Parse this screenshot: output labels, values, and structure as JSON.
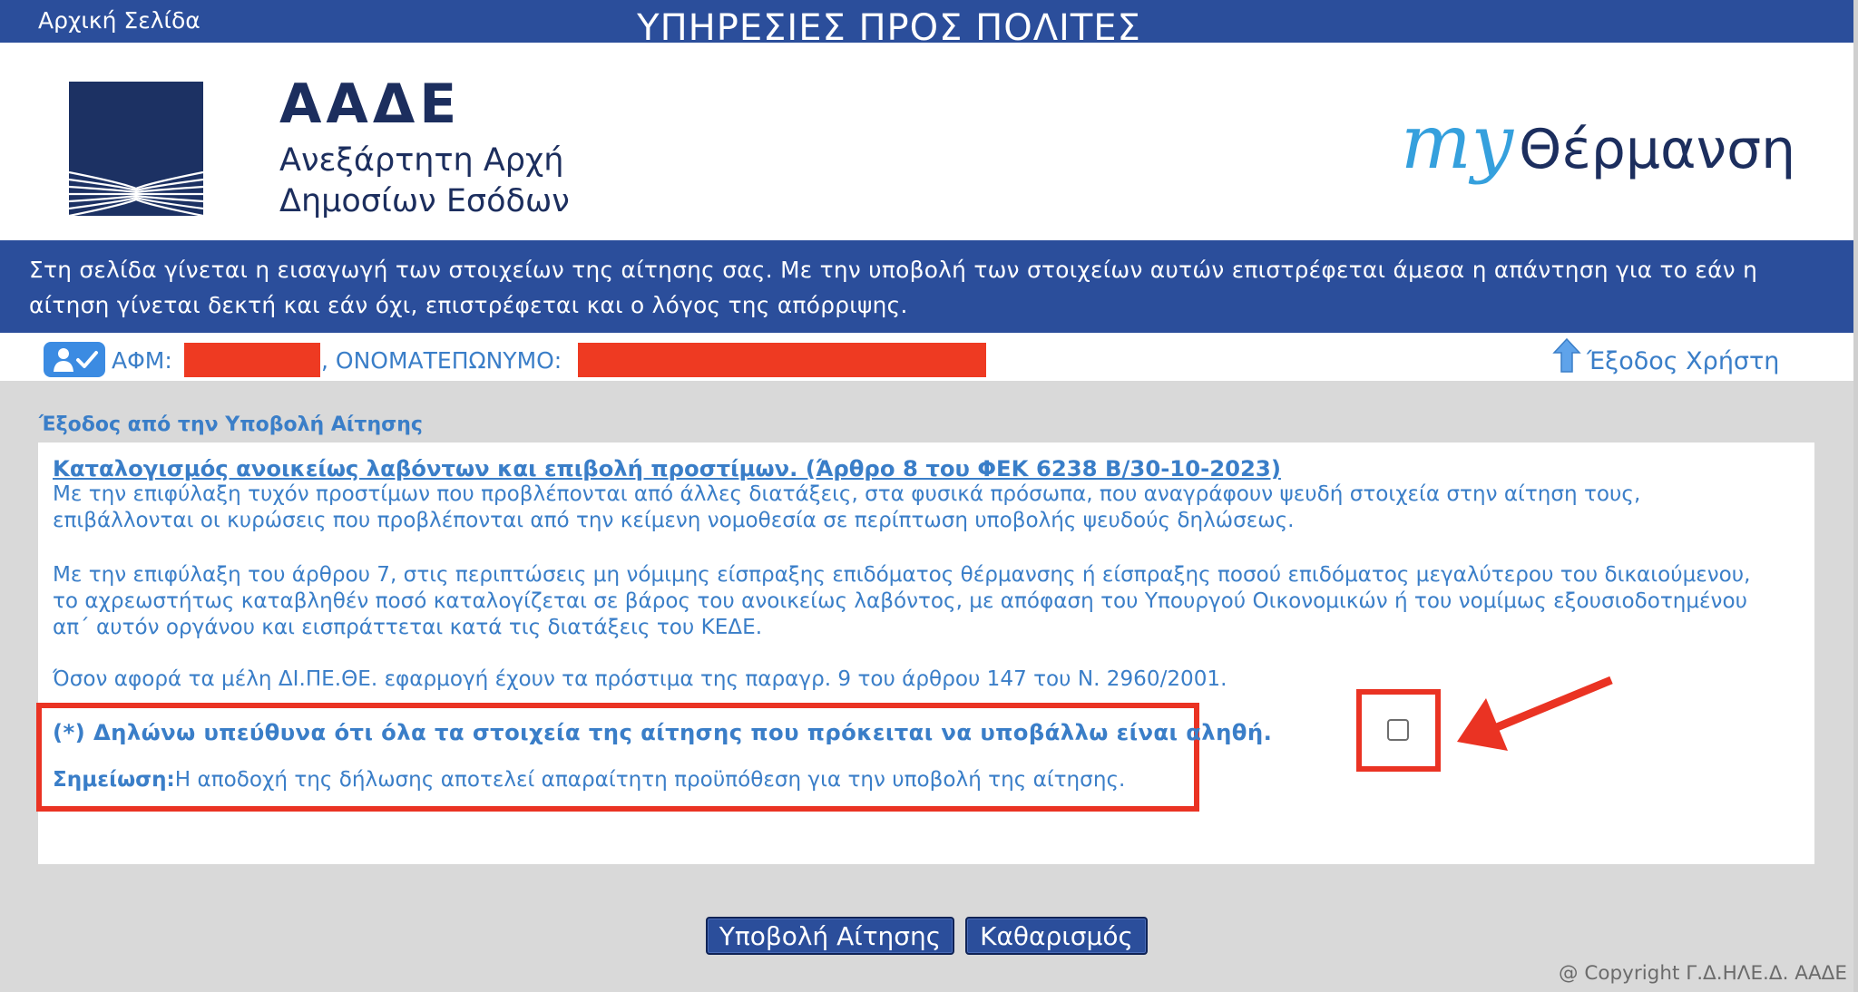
{
  "topbar": {
    "home_link": "Αρχική Σελίδα",
    "title": "ΥΠΗΡΕΣΙΕΣ ΠΡΟΣ ΠΟΛΙΤΕΣ"
  },
  "header": {
    "org_name": "ΑΑΔΕ",
    "org_subtitle_line1": "Ανεξάρτητη Αρχή",
    "org_subtitle_line2": "Δημοσίων Εσόδων",
    "brand_prefix": "my",
    "brand_name": "Θέρμανση"
  },
  "info_banner": "Στη σελίδα γίνεται η εισαγωγή των στοιχείων της αίτησης σας. Με την υποβολή των στοιχείων αυτών επιστρέφεται άμεσα η απάντηση για το εάν η αίτηση γίνεται δεκτή και εάν όχι, επιστρέφεται και ο λόγος της απόρριψης.",
  "user_bar": {
    "afm_label": "ΑΦΜ:",
    "name_label": ", ΟΝΟΜΑΤΕΠΩΝΥΜΟ:",
    "logout_label": "Έξοδος Χρήστη"
  },
  "main": {
    "section_title": "Έξοδος από την Υποβολή Αίτησης",
    "decl_title": "Καταλογισμός ανοικείως λαβόντων και επιβολή προστίμων. (Άρθρο 8 του ΦΕΚ 6238 Β/30-10-2023)",
    "para1_lines": [
      "Με την επιφύλαξη τυχόν προστίμων που προβλέπονται από άλλες διατάξεις, στα φυσικά πρόσωπα, που αναγράφουν ψευδή στοιχεία στην αίτηση τους,",
      "επιβάλλονται οι κυρώσεις που προβλέπονται από την κείμενη νομοθεσία σε περίπτωση υποβολής ψευδούς δηλώσεως."
    ],
    "para2_lines": [
      "Με την επιφύλαξη του άρθρου 7, στις περιπτώσεις μη νόμιμης είσπραξης επιδόματος θέρμανσης ή είσπραξης ποσού επιδόματος μεγαλύτερου του δικαιούμενου,",
      "το αχρεωστήτως καταβληθέν ποσό καταλογίζεται σε βάρος του ανοικείως λαβόντος, με απόφαση του Υπουργού Οικονομικών ή του νομίμως εξουσιοδοτημένου",
      "απ΄ αυτόν οργάνου και εισπράττεται κατά τις διατάξεις του ΚΕΔΕ."
    ],
    "para3": "Όσον αφορά τα μέλη ΔΙ.ΠΕ.ΘΕ. εφαρμογή έχουν τα πρόστιμα της παραγρ. 9 του άρθρου 147 του Ν. 2960/2001.",
    "declaration": "(*) Δηλώνω υπεύθυνα ότι όλα τα στοιχεία της αίτησης που πρόκειται να υποβάλλω είναι αληθή.",
    "note_label": "Σημείωση:",
    "note_text": "Η αποδοχή της δήλωσης αποτελεί απαραίτητη προϋπόθεση για την υποβολή της αίτησης.",
    "accept_checked": false
  },
  "buttons": {
    "submit": "Υποβολή Αίτησης",
    "reset": "Καθαρισμός"
  },
  "footer": {
    "copyright": "@ Copyright Γ.Δ.ΗΛΕ.Δ. ΑΑΔΕ"
  },
  "icons": {
    "user": "user-check-icon",
    "logout": "logout-arrow-icon",
    "annotation": "red-arrow-icon"
  },
  "colors": {
    "primary_blue": "#2b4e9b",
    "text_blue": "#3a7ec8",
    "highlight_red": "#ea3323",
    "background_gray": "#d9d9d9"
  }
}
